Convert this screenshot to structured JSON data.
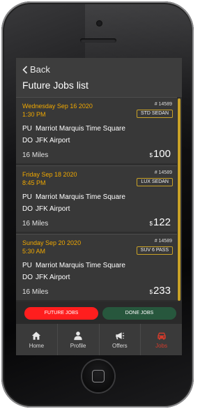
{
  "header": {
    "back_label": "Back",
    "title": "Future Jobs list"
  },
  "jobs": [
    {
      "date": "Wednesday Sep 16 2020",
      "time": "1:30 PM",
      "job_number": "# 14589",
      "vehicle": "STD SEDAN",
      "pu_label": "PU",
      "pickup": "Marriot Marquis Time Square",
      "do_label": "DO",
      "dropoff": "JFK Airport",
      "miles": "16 Miles",
      "currency": "$",
      "price": "100"
    },
    {
      "date": "Friday Sep 18 2020",
      "time": "8:45 PM",
      "job_number": "# 14589",
      "vehicle": "LUX SEDAN",
      "pu_label": "PU",
      "pickup": "Marriot Marquis Time Square",
      "do_label": "DO",
      "dropoff": "JFK Airport",
      "miles": "16 Miles",
      "currency": "$",
      "price": "122"
    },
    {
      "date": "Sunday Sep 20 2020",
      "time": "5:30 AM",
      "job_number": "# 14589",
      "vehicle": "SUV 6 PASS",
      "pu_label": "PU",
      "pickup": "Marriot Marquis Time Square",
      "do_label": "DO",
      "dropoff": "JFK Airport",
      "miles": "16 Miles",
      "currency": "$",
      "price": "233"
    }
  ],
  "buttons": {
    "future": "FUTURE JOBS",
    "done": "DONE JOBS"
  },
  "tabs": [
    {
      "label": "Home",
      "icon": "home-icon"
    },
    {
      "label": "Profile",
      "icon": "user-icon"
    },
    {
      "label": "Offers",
      "icon": "megaphone-icon"
    },
    {
      "label": "Jobs",
      "icon": "car-icon"
    }
  ],
  "colors": {
    "accent_gold": "#f0a800",
    "future_button": "#ff1e1e",
    "done_button": "#27573d",
    "active_tab": "#d43b2b"
  }
}
